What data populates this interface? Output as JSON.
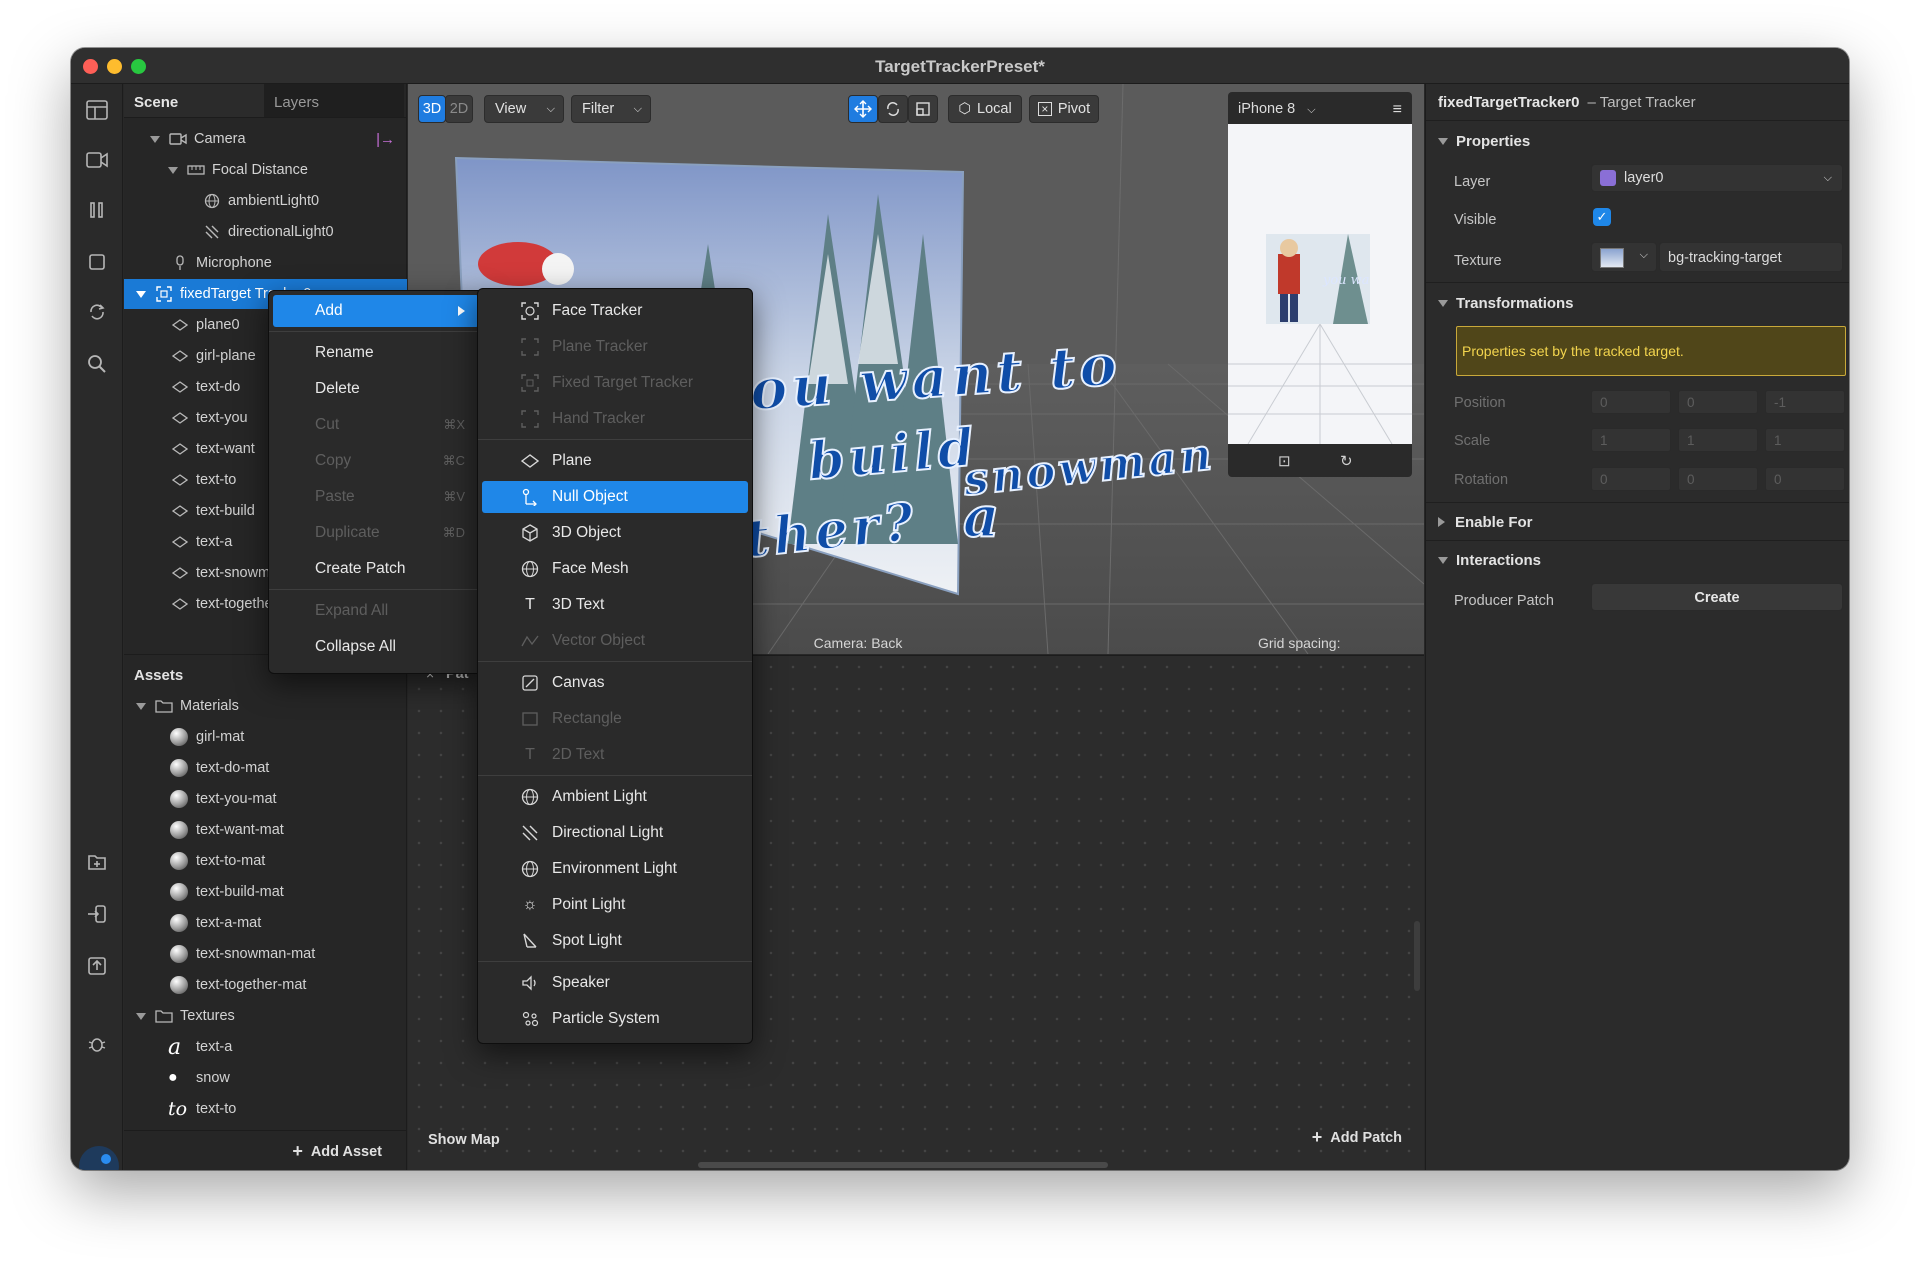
{
  "window": {
    "title": "TargetTrackerPreset*"
  },
  "scene": {
    "tabs": [
      "Scene",
      "Layers"
    ],
    "items": [
      {
        "label": "Camera",
        "icon": "camera-icon"
      },
      {
        "label": "Focal Distance",
        "icon": "focal-distance-icon"
      },
      {
        "label": "ambientLight0",
        "icon": "ambient-light-icon"
      },
      {
        "label": "directionalLight0",
        "icon": "directional-light-icon"
      },
      {
        "label": "Microphone",
        "icon": "microphone-icon"
      },
      {
        "label": "fixedTarget Tracker0",
        "icon": "target-tracker-icon"
      },
      {
        "label": "plane0",
        "icon": "plane-icon"
      },
      {
        "label": "girl-plane",
        "icon": "plane-icon"
      },
      {
        "label": "text-do",
        "icon": "plane-icon"
      },
      {
        "label": "text-you",
        "icon": "plane-icon"
      },
      {
        "label": "text-want",
        "icon": "plane-icon"
      },
      {
        "label": "text-to",
        "icon": "plane-icon"
      },
      {
        "label": "text-build",
        "icon": "plane-icon"
      },
      {
        "label": "text-a",
        "icon": "plane-icon"
      },
      {
        "label": "text-snowman",
        "icon": "plane-icon"
      },
      {
        "label": "text-together",
        "icon": "plane-icon"
      }
    ]
  },
  "assets": {
    "title": "Assets",
    "materials_folder": "Materials",
    "materials": [
      "girl-mat",
      "text-do-mat",
      "text-you-mat",
      "text-want-mat",
      "text-to-mat",
      "text-build-mat",
      "text-a-mat",
      "text-snowman-mat",
      "text-together-mat"
    ],
    "textures_folder": "Textures",
    "textures": [
      "text-a",
      "snow",
      "text-to"
    ],
    "add_asset": "Add Asset"
  },
  "viewport": {
    "btn_3d": "3D",
    "btn_2d": "2D",
    "view": "View",
    "filter": "Filter",
    "local": "Local",
    "pivot": "Pivot",
    "camera_label": "Camera: Back",
    "grid_label": "Grid spacing:",
    "scene_text": [
      "you want to",
      "build",
      "snowman",
      "ether?",
      "a"
    ]
  },
  "simulator": {
    "device": "iPhone 8"
  },
  "patch": {
    "tab": "Pat",
    "show_map": "Show Map",
    "add_patch": "Add Patch"
  },
  "context_menu": {
    "items": [
      {
        "label": "Add",
        "shortcut": ""
      },
      {
        "label": "Rename",
        "shortcut": ""
      },
      {
        "label": "Delete",
        "shortcut": ""
      },
      {
        "label": "Cut",
        "shortcut": "⌘X"
      },
      {
        "label": "Copy",
        "shortcut": "⌘C"
      },
      {
        "label": "Paste",
        "shortcut": "⌘V"
      },
      {
        "label": "Duplicate",
        "shortcut": "⌘D"
      },
      {
        "label": "Create Patch",
        "shortcut": ""
      },
      {
        "label": "Expand All",
        "shortcut": ""
      },
      {
        "label": "Collapse All",
        "shortcut": ""
      }
    ]
  },
  "add_menu": {
    "items": [
      {
        "label": "Face Tracker",
        "icon": "face-tracker-icon"
      },
      {
        "label": "Plane Tracker",
        "icon": "plane-tracker-icon"
      },
      {
        "label": "Fixed Target Tracker",
        "icon": "target-tracker-icon"
      },
      {
        "label": "Hand Tracker",
        "icon": "hand-tracker-icon"
      },
      {
        "label": "Plane",
        "icon": "plane-icon"
      },
      {
        "label": "Null Object",
        "icon": "null-object-icon"
      },
      {
        "label": "3D Object",
        "icon": "cube-icon"
      },
      {
        "label": "Face Mesh",
        "icon": "face-mesh-icon"
      },
      {
        "label": "3D Text",
        "icon": "text-icon"
      },
      {
        "label": "Vector Object",
        "icon": "vector-icon"
      },
      {
        "label": "Canvas",
        "icon": "canvas-icon"
      },
      {
        "label": "Rectangle",
        "icon": "rectangle-icon"
      },
      {
        "label": "2D Text",
        "icon": "text-icon"
      },
      {
        "label": "Ambient Light",
        "icon": "ambient-light-icon"
      },
      {
        "label": "Directional Light",
        "icon": "directional-light-icon"
      },
      {
        "label": "Environment Light",
        "icon": "environment-light-icon"
      },
      {
        "label": "Point Light",
        "icon": "point-light-icon"
      },
      {
        "label": "Spot Light",
        "icon": "spot-light-icon"
      },
      {
        "label": "Speaker",
        "icon": "speaker-icon"
      },
      {
        "label": "Particle System",
        "icon": "particle-icon"
      }
    ]
  },
  "inspector": {
    "title": "fixedTargetTracker0",
    "subtitle": "– Target Tracker",
    "properties": "Properties",
    "layer_label": "Layer",
    "layer_value": "layer0",
    "layer_color": "#8a6fd6",
    "visible_label": "Visible",
    "texture_label": "Texture",
    "texture_value": "bg-tracking-target",
    "transformations": "Transformations",
    "notice": "Properties set by the tracked target.",
    "position_label": "Position",
    "position": [
      "0",
      "0",
      "-1"
    ],
    "scale_label": "Scale",
    "scale": [
      "1",
      "1",
      "1"
    ],
    "rotation_label": "Rotation",
    "rotation": [
      "0",
      "0",
      "0"
    ],
    "enable_for": "Enable For",
    "interactions": "Interactions",
    "producer_patch_label": "Producer Patch",
    "create": "Create"
  },
  "colors": {
    "accent": "#1f87e8",
    "selection": "#1a7ad6",
    "notice_bg": "#5a4f1d",
    "notice_border": "#c9a93a",
    "notice_text": "#f3d54e"
  }
}
